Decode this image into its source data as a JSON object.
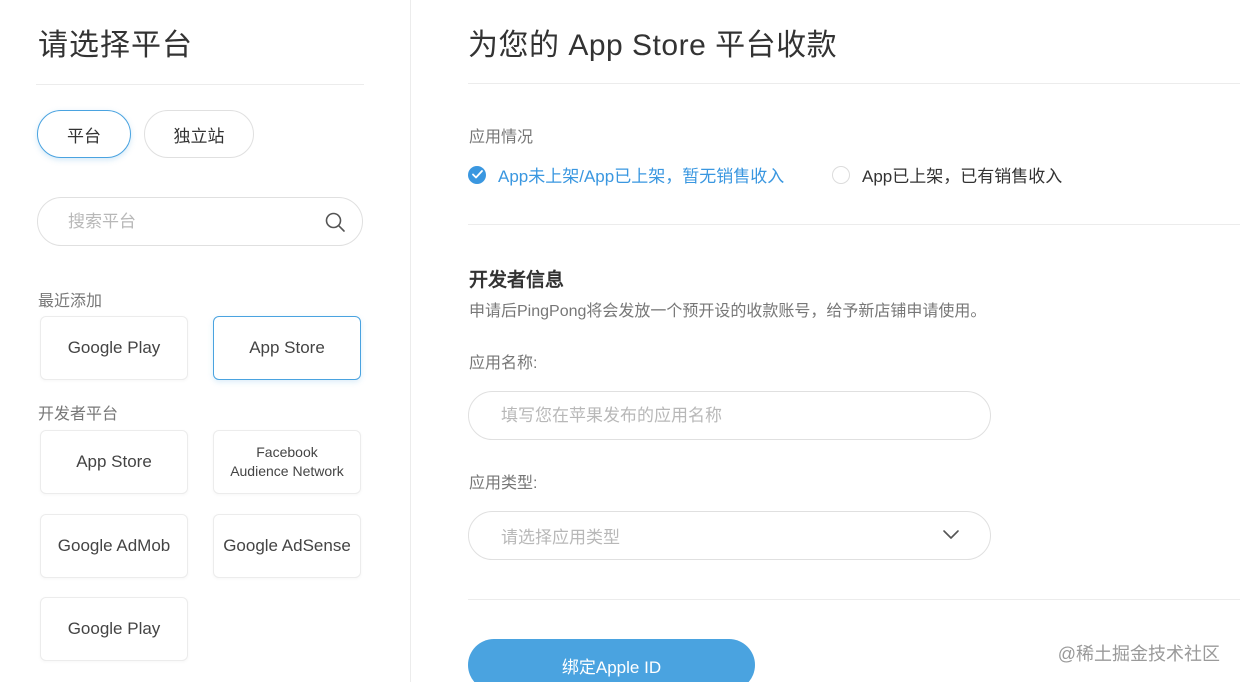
{
  "left": {
    "title": "请选择平台",
    "tabs": [
      {
        "label": "平台",
        "active": true
      },
      {
        "label": "独立站",
        "active": false
      }
    ],
    "search": {
      "placeholder": "搜索平台",
      "icon": "search-icon"
    },
    "recent": {
      "label": "最近添加",
      "items": [
        {
          "label": "Google Play",
          "selected": false
        },
        {
          "label": "App Store",
          "selected": true
        }
      ]
    },
    "developer": {
      "label": "开发者平台",
      "items": [
        {
          "label": "App Store"
        },
        {
          "label_line1": "Facebook",
          "label_line2": "Audience Network"
        },
        {
          "label": "Google AdMob"
        },
        {
          "label": "Google AdSense"
        },
        {
          "label": "Google Play"
        }
      ]
    }
  },
  "right": {
    "title": "为您的 App Store 平台收款",
    "app_status": {
      "label": "应用情况",
      "options": [
        {
          "label": "App未上架/App已上架，暂无销售收入",
          "checked": true
        },
        {
          "label": "App已上架，已有销售收入",
          "checked": false
        }
      ]
    },
    "developer_info": {
      "title": "开发者信息",
      "description": "申请后PingPong将会发放一个预开设的收款账号，给予新店铺申请使用。"
    },
    "app_name": {
      "label": "应用名称:",
      "placeholder": "填写您在苹果发布的应用名称"
    },
    "app_type": {
      "label": "应用类型:",
      "placeholder": "请选择应用类型"
    },
    "bind_button": "绑定Apple ID"
  },
  "watermark": "@稀土掘金技术社区",
  "colors": {
    "accent": "#4aa3e0",
    "radio_checked": "#3a97e0",
    "border": "#e0e0e0"
  }
}
